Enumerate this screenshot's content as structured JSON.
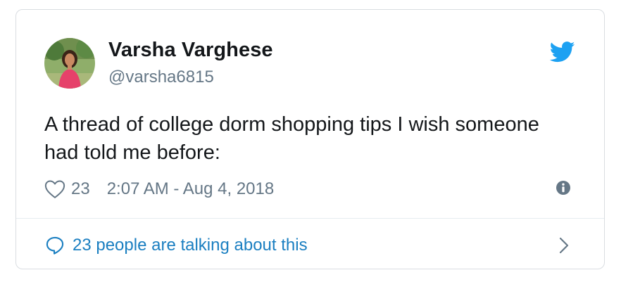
{
  "author": {
    "display_name": "Varsha Varghese",
    "handle": "@varsha6815"
  },
  "tweet": {
    "text": "A thread of college dorm shopping tips I wish someone had told me before:",
    "like_count": "23",
    "timestamp": "2:07 AM - Aug 4, 2018"
  },
  "footer": {
    "conversation_label": "23 people are talking about this"
  },
  "icons": {
    "brand": "twitter-bird-icon",
    "like": "heart-icon",
    "info": "info-icon",
    "reply": "speech-bubble-icon",
    "next": "chevron-right-icon"
  },
  "colors": {
    "brand_blue": "#1da1f2",
    "link_blue": "#1b7fc1",
    "secondary_text": "#657786",
    "primary_text": "#14171a",
    "border": "#d9dde1"
  }
}
